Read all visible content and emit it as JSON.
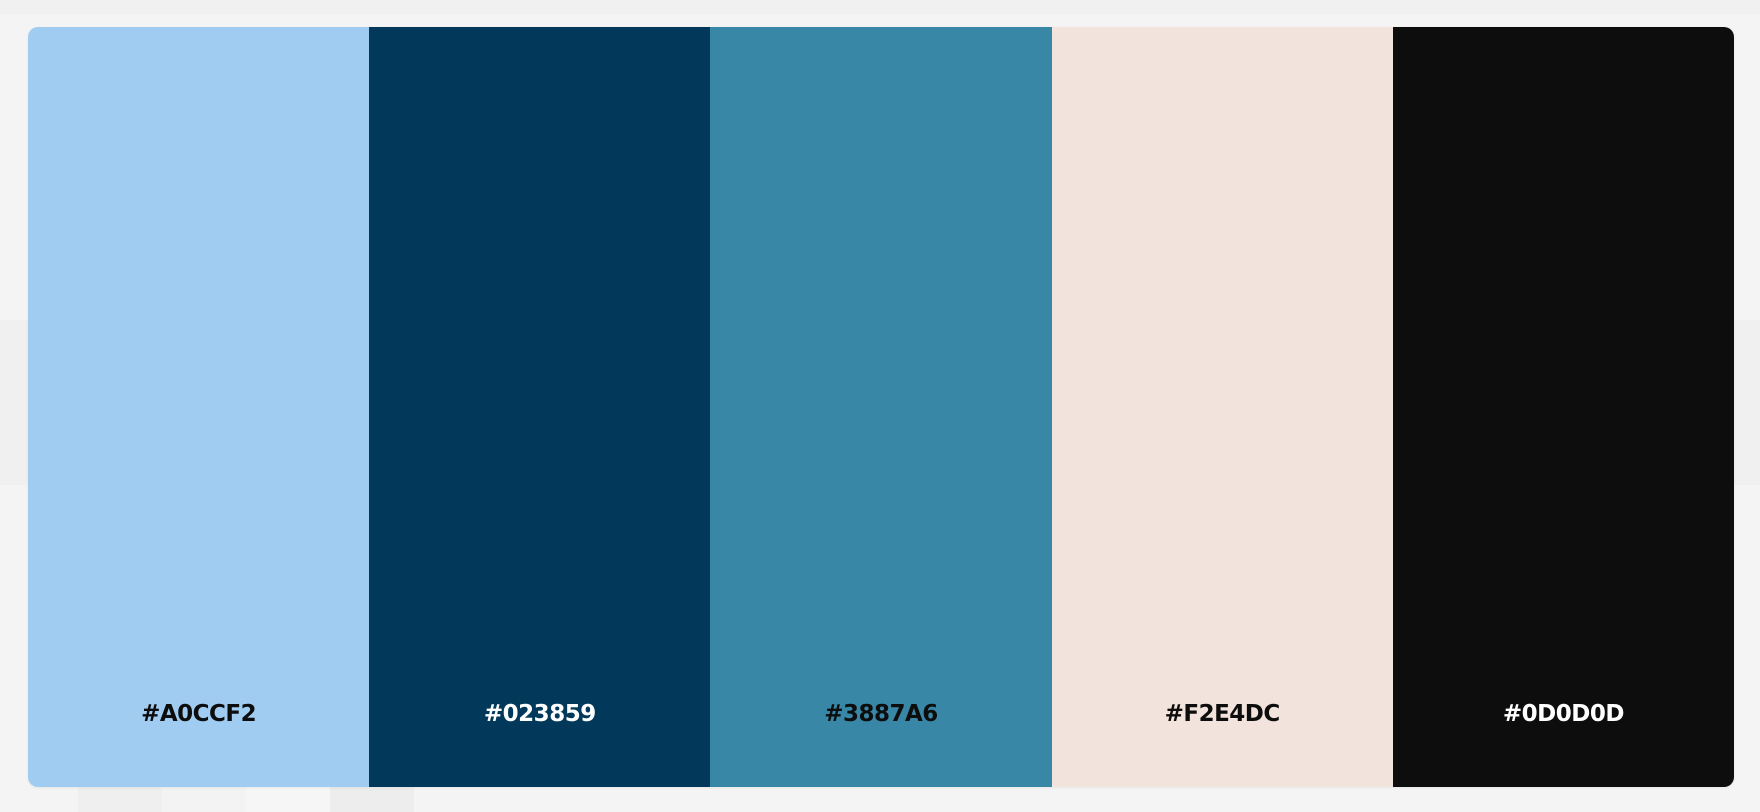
{
  "palette": {
    "swatches": [
      {
        "hex": "#A0CCF2",
        "color": "#A0CCF2",
        "text_color": "#0D0D0D"
      },
      {
        "hex": "#023859",
        "color": "#023859",
        "text_color": "#FFFFFF"
      },
      {
        "hex": "#3887A6",
        "color": "#3887A6",
        "text_color": "#0D0D0D"
      },
      {
        "hex": "#F2E4DC",
        "color": "#F2E4DC",
        "text_color": "#0D0D0D"
      },
      {
        "hex": "#0D0D0D",
        "color": "#0D0D0D",
        "text_color": "#FFFFFF"
      }
    ]
  }
}
